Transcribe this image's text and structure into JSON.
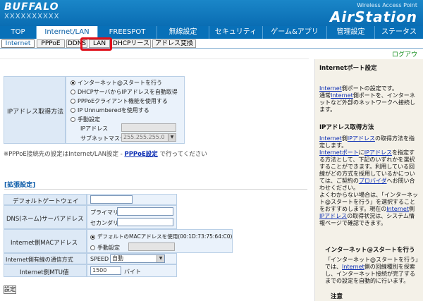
{
  "header": {
    "brand": "BUFFALO",
    "model": "XXXXXXXXXX",
    "ap_sub": "Wireless Access Point",
    "ap_main": "AirStation"
  },
  "nav": {
    "tabs": [
      "TOP",
      "Internet/LAN",
      "FREESPOT",
      "無線設定",
      "セキュリティ",
      "ゲーム&アプリ",
      "管理設定",
      "ステータス"
    ],
    "active": 1
  },
  "subnav": {
    "tabs": [
      "Internet",
      "PPPoE",
      "DDNS",
      "LAN",
      "DHCPリース",
      "アドレス変換"
    ],
    "active": 0
  },
  "logout": "ログアウト",
  "ip_section": {
    "label": "IPアドレス取得方法",
    "options": [
      "インターネット@スタートを行う",
      "DHCPサーバからIPアドレスを自動取得",
      "PPPoEクライアント機能を使用する",
      "IP Unnumberedを使用する",
      "手動設定"
    ],
    "selected": 0,
    "ip_label": "IPアドレス",
    "mask_label": "サブネットマスク",
    "mask_value": "255.255.255.0"
  },
  "pppoe_note": {
    "text": "※PPPoE接続先の設定はInternet/LAN設定 -",
    "link": "PPPoE設定",
    "tail": "で行ってください"
  },
  "advanced": {
    "title": "[拡張設定]",
    "gateway_label": "デフォルトゲートウェイ",
    "dns_label": "DNS(ネーム)サーバアドレス",
    "dns_primary": "プライマリ",
    "dns_secondary": "セカンダリ",
    "mac_label": "Internet側MACアドレス",
    "mac_default": "デフォルトのMACアドレスを使用(00:1D:73:75:64:C0)",
    "mac_manual": "手動設定",
    "speed_label": "Internet側有線の通信方式",
    "speed_prefix": "SPEED",
    "speed_value": "自動",
    "mtu_label": "Internet側MTU値",
    "mtu_value": "1500",
    "mtu_unit": "バイト"
  },
  "submit": "設定",
  "help": {
    "h1": "Internetポート設定",
    "p1a": "Internet",
    "p1b": "側ポートの設定です。",
    "p1c": "通常",
    "p1d": "Internet",
    "p1e": "側ポートを、インターネットなど外部のネットワークへ接続します。",
    "h2": "IPアドレス取得方法",
    "p2a": "Internet",
    "p2b": "側",
    "p2c": "IPアドレス",
    "p2d": "の取得方法を指定します。",
    "p2e": "Internetポート",
    "p2f": "に",
    "p2g": "IPアドレス",
    "p2h": "を指定する方法として、下記のいずれかを選択することができます。利用している回線がどの方式を採用しているかについては、ご契約の",
    "p2i": "プロバイダ",
    "p2j": "へお問い合わせください。",
    "p2k": "よくわからない場合は、「インターネット@スタートを行う」を選択することをおすすめします。現在の",
    "p2l": "Internet",
    "p2m": "側",
    "p2n": "IPアドレス",
    "p2o": "の取得状況は、システム情報ページで確認できます。",
    "h3": "インターネット@スタートを行う",
    "p3a": "「インターネット@スタートを行う」では、",
    "p3b": "Internet",
    "p3c": "側の回線種別を探索し、インターネット接続が完了するまでの設定を自動的に行います。",
    "h4": "注意"
  }
}
